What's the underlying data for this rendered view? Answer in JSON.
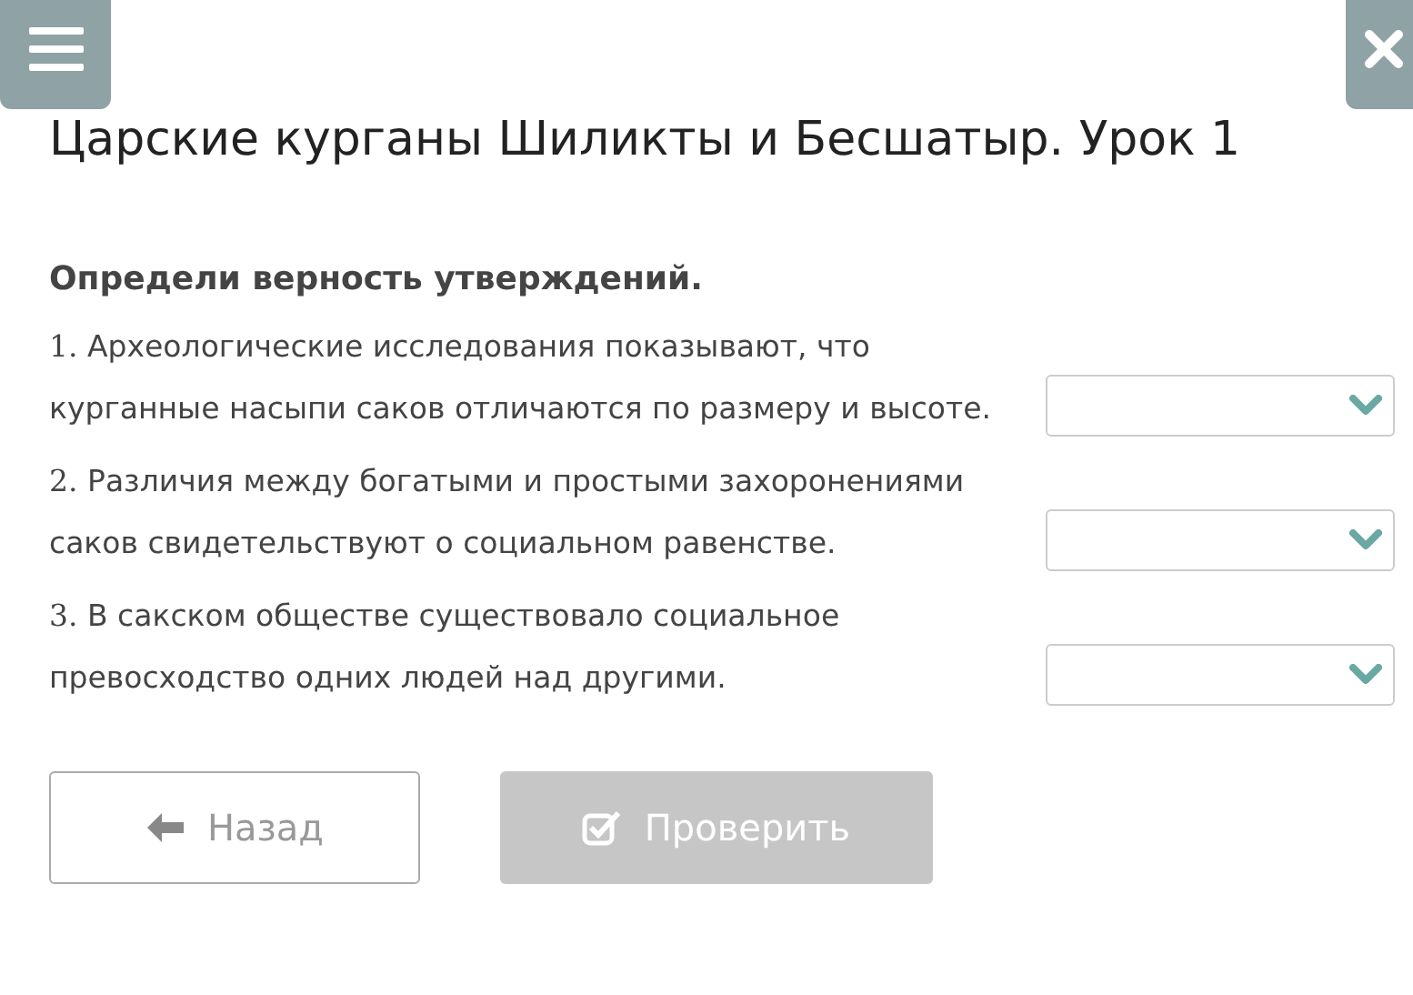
{
  "title": "Царские курганы Шиликты и Бесшатыр. Урок 1",
  "prompt": "Определи верность утверждений.",
  "statements": [
    {
      "number": "1.",
      "text": "Археологические исследования показывают, что курганные насыпи саков отличаются по размеру и высоте."
    },
    {
      "number": "2.",
      "text": "Различия между богатыми и простыми захоронениями саков свидетельствуют о социальном равенстве."
    },
    {
      "number": "3.",
      "text": "В сакском обществе существовало социальное превосходство одних людей над другими."
    }
  ],
  "buttons": [
    {
      "label": "Назад",
      "kind": "back",
      "disabled": false
    },
    {
      "label": "Проверить",
      "kind": "check",
      "disabled": true
    }
  ]
}
